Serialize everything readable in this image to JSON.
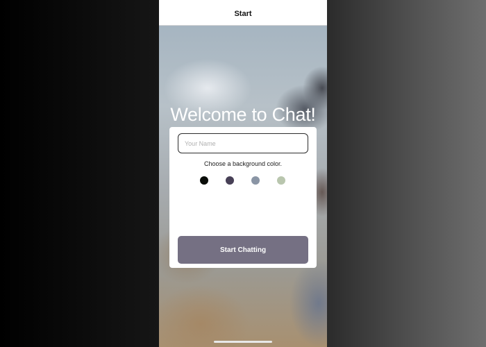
{
  "nav": {
    "title": "Start"
  },
  "main": {
    "welcome_title": "Welcome to Chat!",
    "name_input": {
      "placeholder": "Your Name",
      "value": ""
    },
    "choose_color_label": "Choose a background color.",
    "color_options": [
      {
        "name": "black",
        "hex": "#090C08"
      },
      {
        "name": "dark-purple",
        "hex": "#474056"
      },
      {
        "name": "slate-blue",
        "hex": "#8A95A5"
      },
      {
        "name": "sage-green",
        "hex": "#B9C6AE"
      }
    ],
    "start_button": {
      "label": "Start Chatting",
      "color": "#757083"
    }
  }
}
